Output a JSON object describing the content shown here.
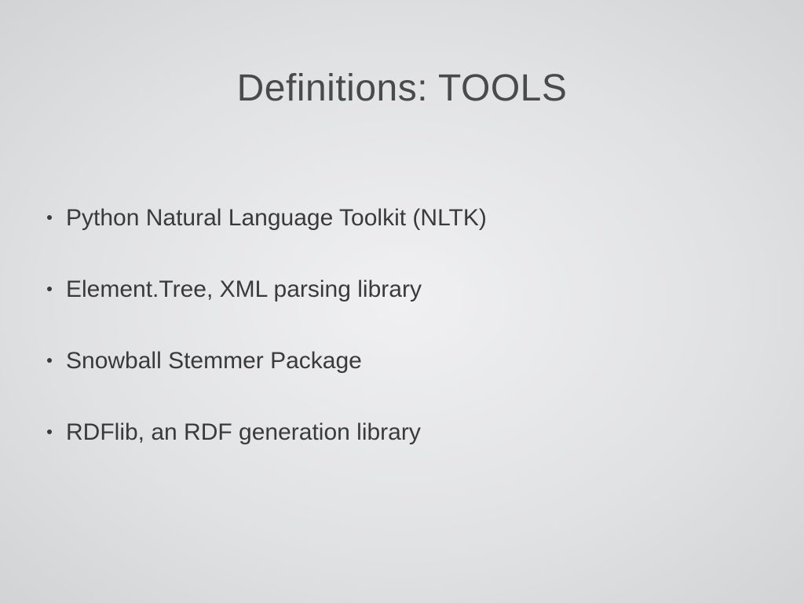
{
  "slide": {
    "title": "Definitions:  TOOLS",
    "bullets": [
      "Python Natural Language Toolkit (NLTK)",
      "Element.Tree, XML parsing library",
      "Snowball Stemmer Package",
      "RDFlib, an RDF generation library"
    ]
  }
}
